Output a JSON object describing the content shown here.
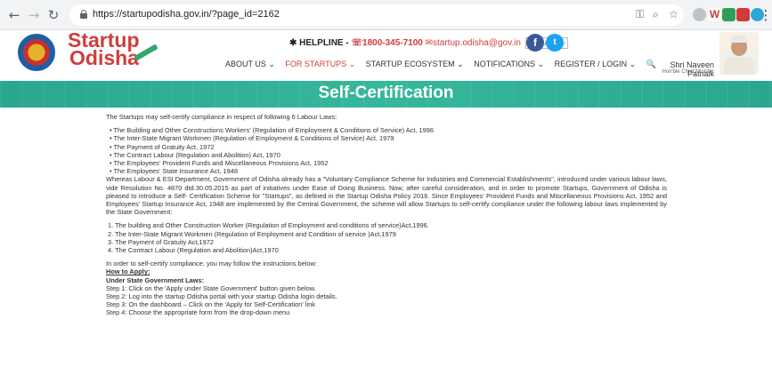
{
  "browser": {
    "back_glyph": "←",
    "forward_glyph": "→",
    "reload_glyph": "↻",
    "url": "https://startupodisha.gov.in/?page_id=2162",
    "bookmark_glyph": "☆",
    "menu_glyph": "⋮"
  },
  "header": {
    "logo_line1": "Startup",
    "logo_line2": "Odisha",
    "helpline_label": "✱ HELPLINE -",
    "helpline_phone": "☏1800-345-7100",
    "helpline_email": "✉startup.odisha@gov.in",
    "font_buttons": [
      "A+",
      "A",
      "A-"
    ],
    "nav": [
      "ABOUT US ⌄",
      "FOR STARTUPS ⌄",
      "STARTUP ECOSYSTEM ⌄",
      "NOTIFICATIONS ⌄",
      "REGISTER / LOGIN ⌄",
      "🔍"
    ],
    "cm_name": "Shri Naveen Patnaik",
    "cm_title": "Hon'ble Chief Minister"
  },
  "banner": {
    "title": "Self-Certification"
  },
  "content": {
    "intro": "The Startups may self-certify compliance in respect of following 6 Labour Laws:",
    "labour_laws": [
      "The Building and Other Constructions Workers' (Regulation of Employment & Conditions of Service) Act, 1996",
      "The Inter-State Migrant Workmen (Regulation of Employment & Conditions of Service) Act, 1979",
      "The Payment of Gratuity Act, 1972",
      "The Contract Labour (Regulation and Abolition) Act, 1970",
      "The Employees' Provident Funds and Miscellaneous Provisions Act, 1952",
      "The Employees' State Insurance Act, 1948"
    ],
    "whereas": "Whereas Labour & ESI Department, Government of Odisha already has a \"Voluntary Compliance Scheme for Industries and Commercial Establishments\", introduced under various labour laws, vide Resolution No. 4870 dtd.30.05.2015 as part of initiatives under Ease of Doing Business. Now, after careful consideration, and in order to promote Startups, Government of Odisha is pleased to introduce a Self- Certification Scheme for \"Startups\", as defined in the Startup Odisha Policy 2016. Since Employees' Provident Funds and Miscellaneous Provisions Act, 1952 and Employees' Startup Insurance Act, 1948 are implemented by the Central Government, the scheme will allow Startups to self-certify compliance under the following labour laws implemented by the State Government:",
    "state_laws": [
      "1. The building and Other Construction Worker (Regulation of Employment and conditions of service)Act,1996.",
      "2. The Inter-State Migrant Workmen (Regulation of Employment and Condition of service )Act,1979",
      "3. The Payment of Gratuity Act,1972",
      "4. The Contract Labour (Regulation and Abolition)Act,1970"
    ],
    "instructions_intro": "In order to self-certify compliance, you may follow the instructions below:",
    "how_to_apply": "How to Apply:",
    "under_state": "Under State Government Laws:",
    "steps": [
      "Step 1: Click on the 'Apply under State Government' button given below.",
      "Step 2: Log into the startup Odisha portal with your startup Odisha login details.",
      "Step 3: On the dashboard – Click on the 'Apply for Self-Certification' link",
      "Step 4: Choose the appropriate form from the drop-down menu"
    ]
  }
}
